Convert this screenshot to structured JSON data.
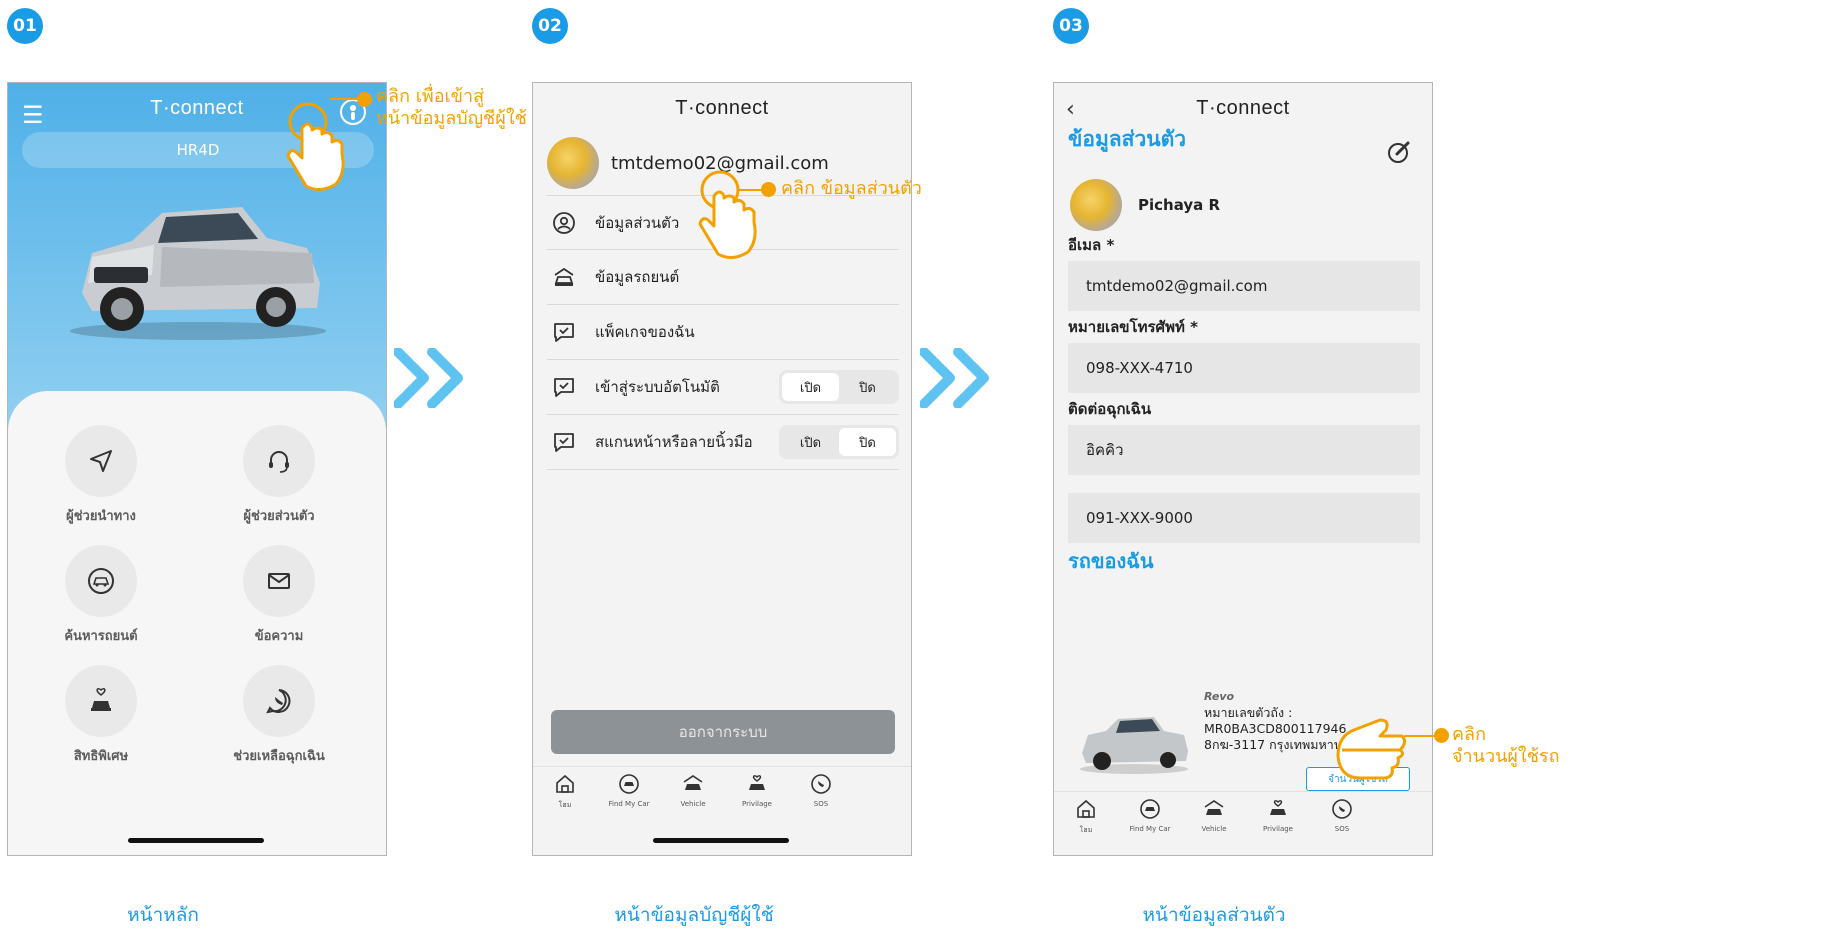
{
  "steps": [
    {
      "number": "01",
      "caption": "หน้าหลัก"
    },
    {
      "number": "02",
      "caption": "หน้าข้อมูลบัญชีผู้ใช้"
    },
    {
      "number": "03",
      "caption": "หน้าข้อมูลส่วนตัว"
    }
  ],
  "brand_logo": "T·connect",
  "colors": {
    "accent": "#1a9be6",
    "callout": "#f2a100",
    "top_gradient_start": "#4fb0e8",
    "logout_bg": "#8d9296"
  },
  "home": {
    "menu_icon": "hamburger-icon",
    "model": "HR4D",
    "features": [
      {
        "label": "ผู้ช่วยนำทาง",
        "icon": "navigation-arrow-icon"
      },
      {
        "label": "ผู้ช่วยส่วนตัว",
        "icon": "headset-icon"
      },
      {
        "label": "ค้นหารถยนต์",
        "icon": "find-car-icon"
      },
      {
        "label": "ข้อความ",
        "icon": "mail-icon"
      },
      {
        "label": "สิทธิพิเศษ",
        "icon": "privilege-car-icon"
      },
      {
        "label": "ช่วยเหลือฉุกเฉิน",
        "icon": "sos-phone-icon"
      }
    ],
    "callout_line1": "คลิก เพื่อเข้าสู่",
    "callout_line2": "หน้าข้อมูลบัญชีผู้ใช้"
  },
  "account": {
    "email": "tmtdemo02@gmail.com",
    "menu": [
      {
        "label": "ข้อมูลส่วนตัว",
        "icon": "person-circle-icon"
      },
      {
        "label": "ข้อมูลรถยนต์",
        "icon": "car-icon"
      },
      {
        "label": "แพ็คเกจของฉัน",
        "icon": "package-check-icon"
      },
      {
        "label": "เข้าสู่ระบบอัตโนมัติ",
        "icon": "chat-check-icon",
        "toggle": {
          "on": "เปิด",
          "off": "ปิด",
          "selected": "on"
        }
      },
      {
        "label": "สแกนหน้าหรือลายนิ้วมือ",
        "icon": "chat-check-icon",
        "toggle": {
          "on": "เปิด",
          "off": "ปิด",
          "selected": "off"
        }
      }
    ],
    "logout": "ออกจากระบบ",
    "callout": "คลิก ข้อมูลส่วนตัว"
  },
  "tabs": [
    {
      "label": "โฮม",
      "icon": "home-icon"
    },
    {
      "label": "Find My Car",
      "icon": "find-car-icon"
    },
    {
      "label": "Vehicle",
      "icon": "car-icon"
    },
    {
      "label": "Privilage",
      "icon": "privilege-car-icon"
    },
    {
      "label": "SOS",
      "icon": "sos-phone-icon"
    }
  ],
  "profile": {
    "title": "ข้อมูลส่วนตัว",
    "name": "Pichaya R",
    "email_label": "อีเมล *",
    "email": "tmtdemo02@gmail.com",
    "phone_label": "หมายเลขโทรศัพท์ *",
    "phone": "098-XXX-4710",
    "emergency_label": "ติดต่อฉุกเฉิน",
    "emergency_name": "อิคคิว",
    "emergency_phone": "091-XXX-9000",
    "my_cars_title": "รถของฉัน",
    "car": {
      "brand": "Revo",
      "chassis_label": "หมายเลขตัวถัง :",
      "chassis": "MR0BA3CD800117946",
      "plate": "8กฆ-3117 กรุงเทพมหานคร",
      "users_button": "จำนวนผู้ใช้รถ"
    },
    "callout_line1": "คลิก",
    "callout_line2": "จำนวนผู้ใช้รถ"
  }
}
